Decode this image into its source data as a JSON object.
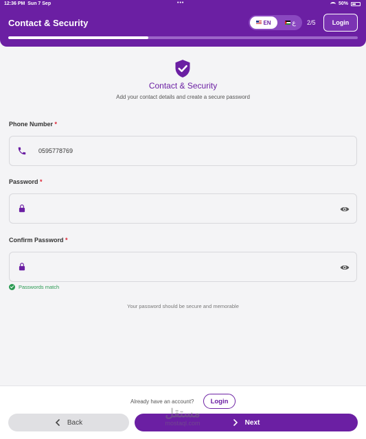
{
  "status_bar": {
    "time": "12:36 PM",
    "date": "Sun 7 Sep",
    "dots": "•••",
    "battery": "50%"
  },
  "header": {
    "title": "Contact & Security",
    "lang_en": "EN",
    "lang_ar": "ع",
    "step": "2/5",
    "login_label": "Login",
    "progress_fraction": 0.4
  },
  "section": {
    "title": "Contact & Security",
    "subtitle": "Add your contact details and create a secure password"
  },
  "form": {
    "phone": {
      "label": "Phone Number",
      "required_mark": "*",
      "value": "0595778769"
    },
    "password": {
      "label": "Password",
      "required_mark": "*",
      "value": ""
    },
    "confirm": {
      "label": "Confirm Password",
      "required_mark": "*",
      "value": ""
    },
    "match_text": "Passwords match",
    "hint": "Your password should be secure and memorable"
  },
  "footer": {
    "already_text": "Already have an account?",
    "login_label": "Login",
    "back_label": "Back",
    "next_label": "Next"
  },
  "watermark": {
    "ar": "مستقل",
    "en": "mostaql.com"
  },
  "colors": {
    "brand": "#6b1fa3",
    "success": "#2a9a52",
    "required": "#d22233"
  }
}
